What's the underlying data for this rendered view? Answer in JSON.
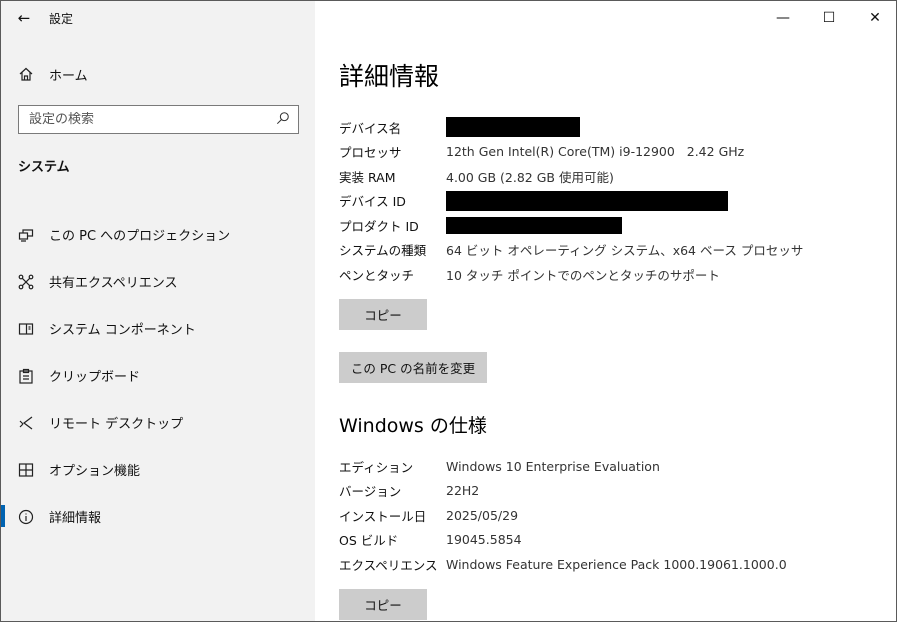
{
  "app": {
    "title": "設定"
  },
  "window_controls": {
    "minimize": "—",
    "maximize": "☐",
    "close": "✕"
  },
  "sidebar": {
    "home_label": "ホーム",
    "search_placeholder": "設定の検索",
    "section_label": "システム",
    "items": [
      {
        "label": "この PC へのプロジェクション",
        "icon": "projection-icon",
        "active": false
      },
      {
        "label": "共有エクスペリエンス",
        "icon": "shared-experience-icon",
        "active": false
      },
      {
        "label": "システム コンポーネント",
        "icon": "system-components-icon",
        "active": false
      },
      {
        "label": "クリップボード",
        "icon": "clipboard-icon",
        "active": false
      },
      {
        "label": "リモート デスクトップ",
        "icon": "remote-desktop-icon",
        "active": false
      },
      {
        "label": "オプション機能",
        "icon": "optional-features-icon",
        "active": false
      },
      {
        "label": "詳細情報",
        "icon": "info-icon",
        "active": true
      }
    ]
  },
  "main": {
    "title": "詳細情報",
    "device_specs": [
      {
        "label": "デバイス名",
        "value": "",
        "redacted": true
      },
      {
        "label": "プロセッサ",
        "value": "12th Gen Intel(R) Core(TM) i9-12900   2.42 GHz",
        "redacted": false
      },
      {
        "label": "実装 RAM",
        "value": "4.00 GB (2.82 GB 使用可能)",
        "redacted": false
      },
      {
        "label": "デバイス ID",
        "value": "",
        "redacted": true
      },
      {
        "label": "プロダクト ID",
        "value": "",
        "redacted": true
      },
      {
        "label": "システムの種類",
        "value": "64 ビット オペレーティング システム、x64 ベース プロセッサ",
        "redacted": false
      },
      {
        "label": "ペンとタッチ",
        "value": "10 タッチ ポイントでのペンとタッチのサポート",
        "redacted": false
      }
    ],
    "copy_button_label": "コピー",
    "rename_button_label": "この PC の名前を変更",
    "windows_heading": "Windows の仕様",
    "windows_specs": [
      {
        "label": "エディション",
        "value": "Windows 10 Enterprise Evaluation"
      },
      {
        "label": "バージョン",
        "value": "22H2"
      },
      {
        "label": "インストール日",
        "value": "2025/05/29"
      },
      {
        "label": "OS ビルド",
        "value": "19045.5854"
      },
      {
        "label": "エクスペリエンス",
        "value": "Windows Feature Experience Pack 1000.19061.1000.0"
      }
    ],
    "copy_button_2_label": "コピー"
  },
  "colors": {
    "accent": "#0063b1",
    "sidebar_bg": "#f2f2f2",
    "button_bg": "#cccccc"
  }
}
